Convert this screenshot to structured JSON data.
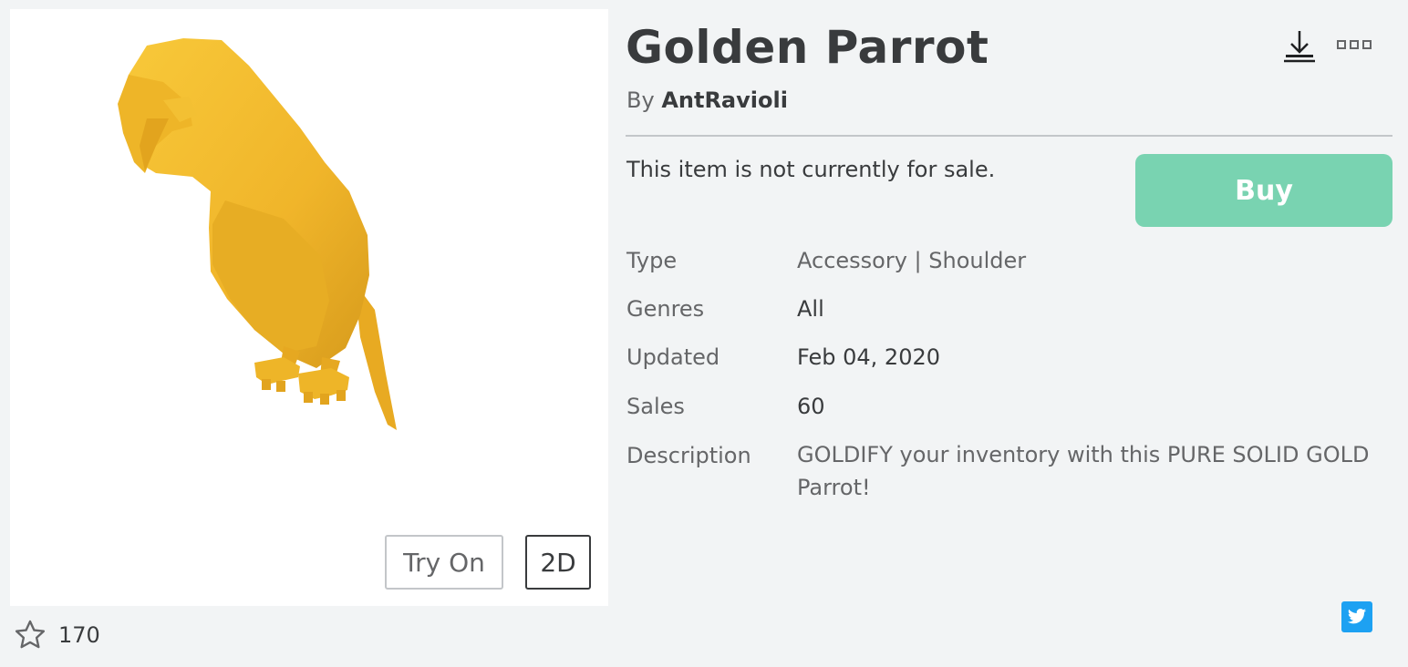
{
  "item": {
    "title": "Golden Parrot",
    "by_prefix": "By",
    "creator": "AntRavioli",
    "sale_status": "This item is not currently for sale.",
    "buy_label": "Buy",
    "details": {
      "type_label": "Type",
      "type_value": "Accessory | Shoulder",
      "genres_label": "Genres",
      "genres_value": "All",
      "updated_label": "Updated",
      "updated_value": "Feb 04, 2020",
      "sales_label": "Sales",
      "sales_value": "60",
      "description_label": "Description",
      "description_value": "GOLDIFY your inventory with this PURE SOLID GOLD Parrot!"
    }
  },
  "preview": {
    "try_on_label": "Try On",
    "view_2d_label": "2D"
  },
  "favorites": {
    "count": "170",
    "icon": "star-outline-icon"
  },
  "icons": {
    "download": "download-icon",
    "more": "more-options-icon",
    "twitter": "twitter-icon"
  },
  "colors": {
    "buy_button": "#79d3b1",
    "parrot_gold": "#f5bd2c",
    "twitter": "#1da1f2",
    "text_primary": "#393b3d",
    "text_secondary": "#656668"
  }
}
